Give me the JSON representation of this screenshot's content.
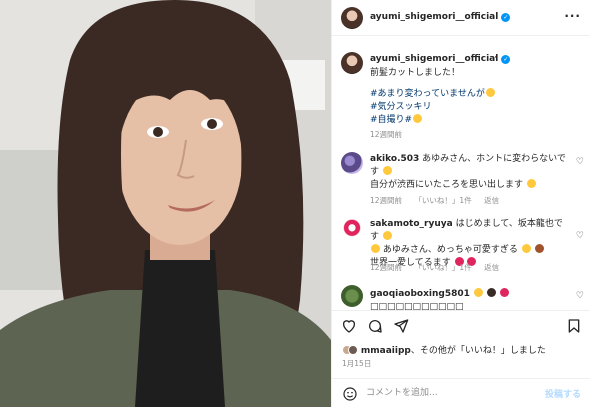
{
  "post": {
    "username": "ayumi_shigemori__official",
    "more_icon": "more-horizontal-icon",
    "caption_line1": "前髪カットしました！",
    "hashtags": [
      "#あまり変わっていませんが",
      "#気分スッキリ",
      "#自撮り#"
    ],
    "caption_time": "12週間前",
    "likes_by": "mmaaiipp",
    "likes_suffix": "、その他が「いいね！」しました",
    "date": "1月15日"
  },
  "comments": [
    {
      "user": "akiko.503",
      "text": "あゆみさん、ホントに変わらないです",
      "text2": "自分が渋西にいたころを思い出します",
      "time": "12週間前",
      "likes": "「いいね！」1件",
      "reply": "返信"
    },
    {
      "user": "sakamoto_ryuya",
      "text": "はじめまして、坂本龍也です",
      "text2": "あゆみさん、めっちゃ可愛すぎる",
      "text3": "世界一愛してるます",
      "time": "12週間前",
      "likes": "「いいね！」1件",
      "reply": "返信"
    },
    {
      "user": "gaoqiaoboxing5801",
      "text": "□□□□□□□□□□□",
      "time": "",
      "likes": "",
      "reply": ""
    }
  ],
  "comment_box": {
    "placeholder": "コメントを追加...",
    "post_label": "投稿する"
  },
  "colors": {
    "accent": "#0095f6",
    "link": "#00376b",
    "muted": "#8e8e8e"
  }
}
